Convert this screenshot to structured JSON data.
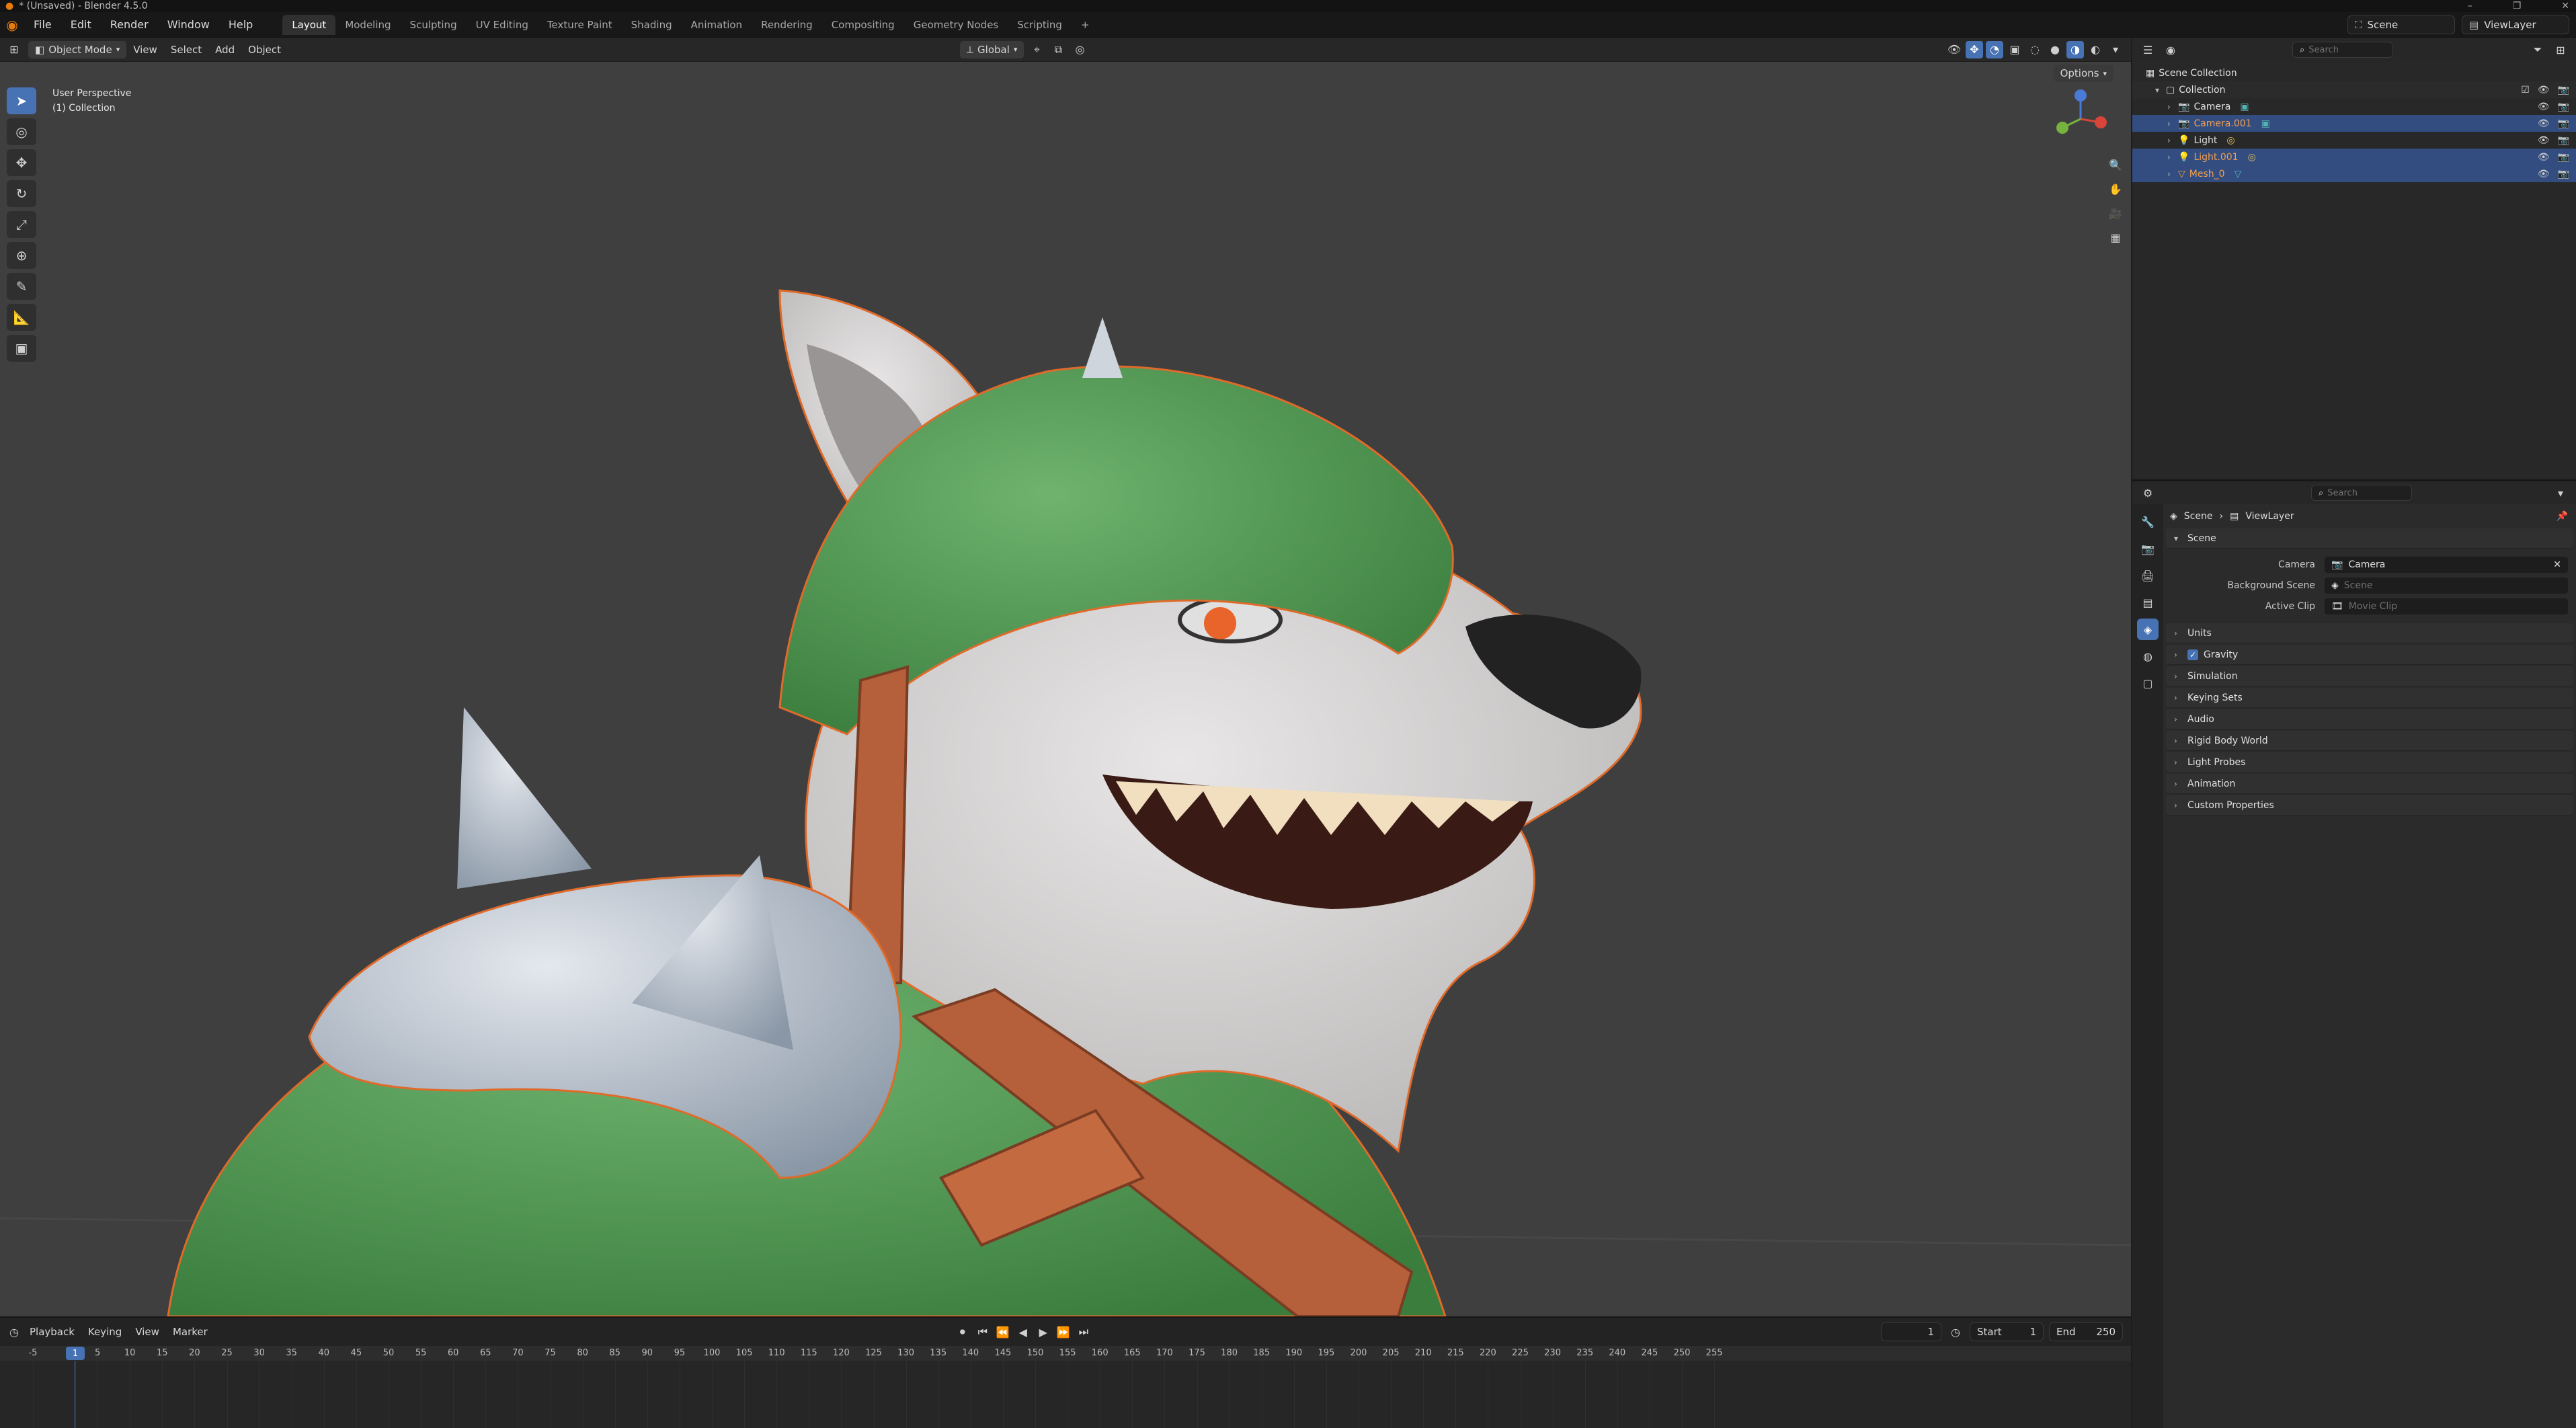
{
  "window": {
    "title": "* (Unsaved) - Blender 4.5.0"
  },
  "menubar": {
    "menus": [
      "File",
      "Edit",
      "Render",
      "Window",
      "Help"
    ],
    "workspaces": [
      "Layout",
      "Modeling",
      "Sculpting",
      "UV Editing",
      "Texture Paint",
      "Shading",
      "Animation",
      "Rendering",
      "Compositing",
      "Geometry Nodes",
      "Scripting"
    ],
    "active_workspace": "Layout",
    "add_tab": "+",
    "scene": "Scene",
    "view_layer": "ViewLayer"
  },
  "viewport_header": {
    "mode": "Object Mode",
    "menus": [
      "View",
      "Select",
      "Add",
      "Object"
    ],
    "transform_orientation": "Global",
    "options": "Options"
  },
  "viewport": {
    "perspective": "User Perspective",
    "collection": "(1) Collection"
  },
  "outliner": {
    "search_placeholder": "Search",
    "root": "Scene Collection",
    "collection": "Collection",
    "items": [
      {
        "name": "Camera",
        "icon": "camera-icon",
        "selected": false
      },
      {
        "name": "Camera.001",
        "icon": "camera-icon",
        "selected": true
      },
      {
        "name": "Light",
        "icon": "light-icon",
        "selected": false
      },
      {
        "name": "Light.001",
        "icon": "light-icon",
        "selected": true
      },
      {
        "name": "Mesh_0",
        "icon": "mesh-icon",
        "selected": true
      }
    ]
  },
  "properties": {
    "search_placeholder": "Search",
    "breadcrumb": [
      "Scene",
      "ViewLayer"
    ],
    "panel_title": "Scene",
    "fields": {
      "camera_label": "Camera",
      "camera_value": "Camera",
      "background_scene_label": "Background Scene",
      "background_scene_placeholder": "Scene",
      "active_clip_label": "Active Clip",
      "active_clip_placeholder": "Movie Clip"
    },
    "subpanels": [
      "Units",
      "Gravity",
      "Simulation",
      "Keying Sets",
      "Audio",
      "Rigid Body World",
      "Light Probes",
      "Animation",
      "Custom Properties"
    ]
  },
  "timeline": {
    "menus": [
      "Playback",
      "Keying",
      "View",
      "Marker"
    ],
    "current_frame": "1",
    "start_label": "Start",
    "start_value": "1",
    "end_label": "End",
    "end_value": "250",
    "ticks": [
      "-5",
      "1",
      "5",
      "10",
      "15",
      "20",
      "25",
      "30",
      "35",
      "40",
      "45",
      "50",
      "55",
      "60",
      "65",
      "70",
      "75",
      "80",
      "85",
      "90",
      "95",
      "100",
      "105",
      "110",
      "115",
      "120",
      "125",
      "130",
      "135",
      "140",
      "145",
      "150",
      "155",
      "160",
      "165",
      "170",
      "175",
      "180",
      "185",
      "190",
      "195",
      "200",
      "205",
      "210",
      "215",
      "220",
      "225",
      "230",
      "235",
      "240",
      "245",
      "250",
      "255"
    ]
  }
}
